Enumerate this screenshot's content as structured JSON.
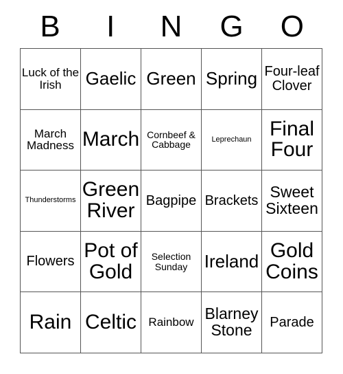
{
  "card": {
    "title": "BINGO",
    "header_letters": [
      "B",
      "I",
      "N",
      "G",
      "O"
    ],
    "columns": 5,
    "rows": 5,
    "border_color": "#555555",
    "text_color": "#000000",
    "background_color": "#ffffff",
    "cells": [
      [
        {
          "text": "Luck of the Irish",
          "size": "sm"
        },
        {
          "text": "Gaelic",
          "size": "xl"
        },
        {
          "text": "Green",
          "size": "xl"
        },
        {
          "text": "Spring",
          "size": "xl"
        },
        {
          "text": "Four-leaf Clover",
          "size": "md"
        }
      ],
      [
        {
          "text": "March Madness",
          "size": "sm"
        },
        {
          "text": "March",
          "size": "xxl"
        },
        {
          "text": "Cornbeef & Cabbage",
          "size": "xs"
        },
        {
          "text": "Leprechaun",
          "size": "xxs"
        },
        {
          "text": "Final Four",
          "size": "xxl"
        }
      ],
      [
        {
          "text": "Thunderstorms",
          "size": "xxs"
        },
        {
          "text": "Green River",
          "size": "xxl"
        },
        {
          "text": "Bagpipe",
          "size": "md"
        },
        {
          "text": "Brackets",
          "size": "md"
        },
        {
          "text": "Sweet Sixteen",
          "size": "lg"
        }
      ],
      [
        {
          "text": "Flowers",
          "size": "md"
        },
        {
          "text": "Pot of Gold",
          "size": "xxl"
        },
        {
          "text": "Selection Sunday",
          "size": "xs"
        },
        {
          "text": "Ireland",
          "size": "xl"
        },
        {
          "text": "Gold Coins",
          "size": "xxl"
        }
      ],
      [
        {
          "text": "Rain",
          "size": "xxl"
        },
        {
          "text": "Celtic",
          "size": "xxl"
        },
        {
          "text": "Rainbow",
          "size": "sm"
        },
        {
          "text": "Blarney Stone",
          "size": "lg"
        },
        {
          "text": "Parade",
          "size": "md"
        }
      ]
    ]
  }
}
